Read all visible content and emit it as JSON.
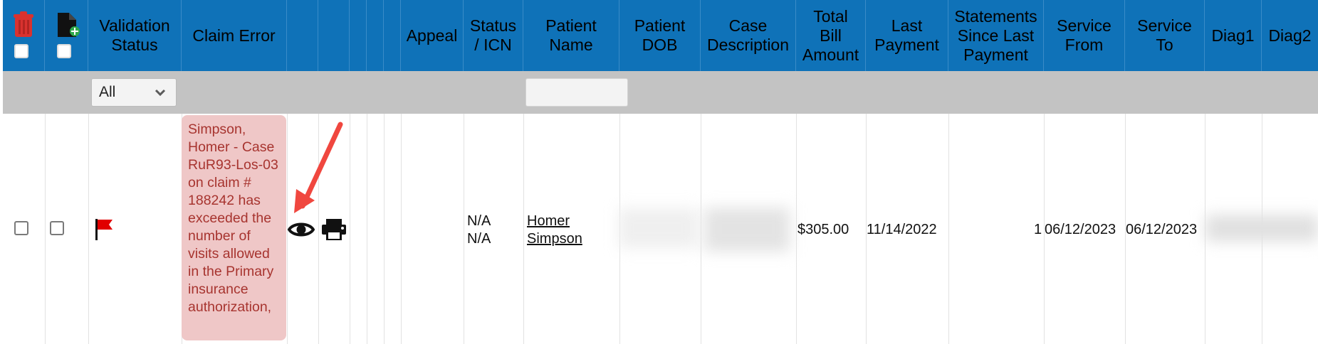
{
  "columns": {
    "validation_status": [
      "Validation",
      "Status"
    ],
    "claim_error": [
      "Claim Error"
    ],
    "appeal": [
      "Appeal"
    ],
    "status_icn": [
      "Status",
      "/ ICN"
    ],
    "patient_name": [
      "Patient",
      "Name"
    ],
    "patient_dob": [
      "Patient",
      "DOB"
    ],
    "case_description": [
      "Case",
      "Description"
    ],
    "total_bill_amount": [
      "Total",
      "Bill",
      "Amount"
    ],
    "last_payment": [
      "Last",
      "Payment"
    ],
    "statements_since_last_payment": [
      "Statements",
      "Since Last",
      "Payment"
    ],
    "service_from": [
      "Service",
      "From"
    ],
    "service_to": [
      "Service",
      "To"
    ],
    "diag1": [
      "Diag1"
    ],
    "diag2": [
      "Diag2"
    ]
  },
  "filters": {
    "validation_status": "All",
    "patient_name": ""
  },
  "row": {
    "claim_error": "Simpson, Homer - Case RuR93-Los-03 on claim # 188242 has exceeded the number of visits allowed in the Primary insurance authorization,",
    "status_line1": "N/A",
    "status_line2": "N/A",
    "patient_first": "Homer",
    "patient_last": "Simpson",
    "total_bill_amount": "$305.00",
    "last_payment": "11/14/2022",
    "statements_since_last_payment": "1",
    "service_from": "06/12/2023",
    "service_to": "06/12/2023"
  },
  "colors": {
    "header": "#0f72b8",
    "filter_bar": "#c3c3c3",
    "error_bg": "#efc7c7",
    "error_text": "#a7342f",
    "trash": "#d9322f",
    "flag": "#e10000",
    "arrow": "#f0473f"
  },
  "icons": [
    "trash-icon",
    "export-document-icon",
    "flag-icon",
    "eye-icon",
    "print-icon",
    "chevron-down-icon"
  ]
}
